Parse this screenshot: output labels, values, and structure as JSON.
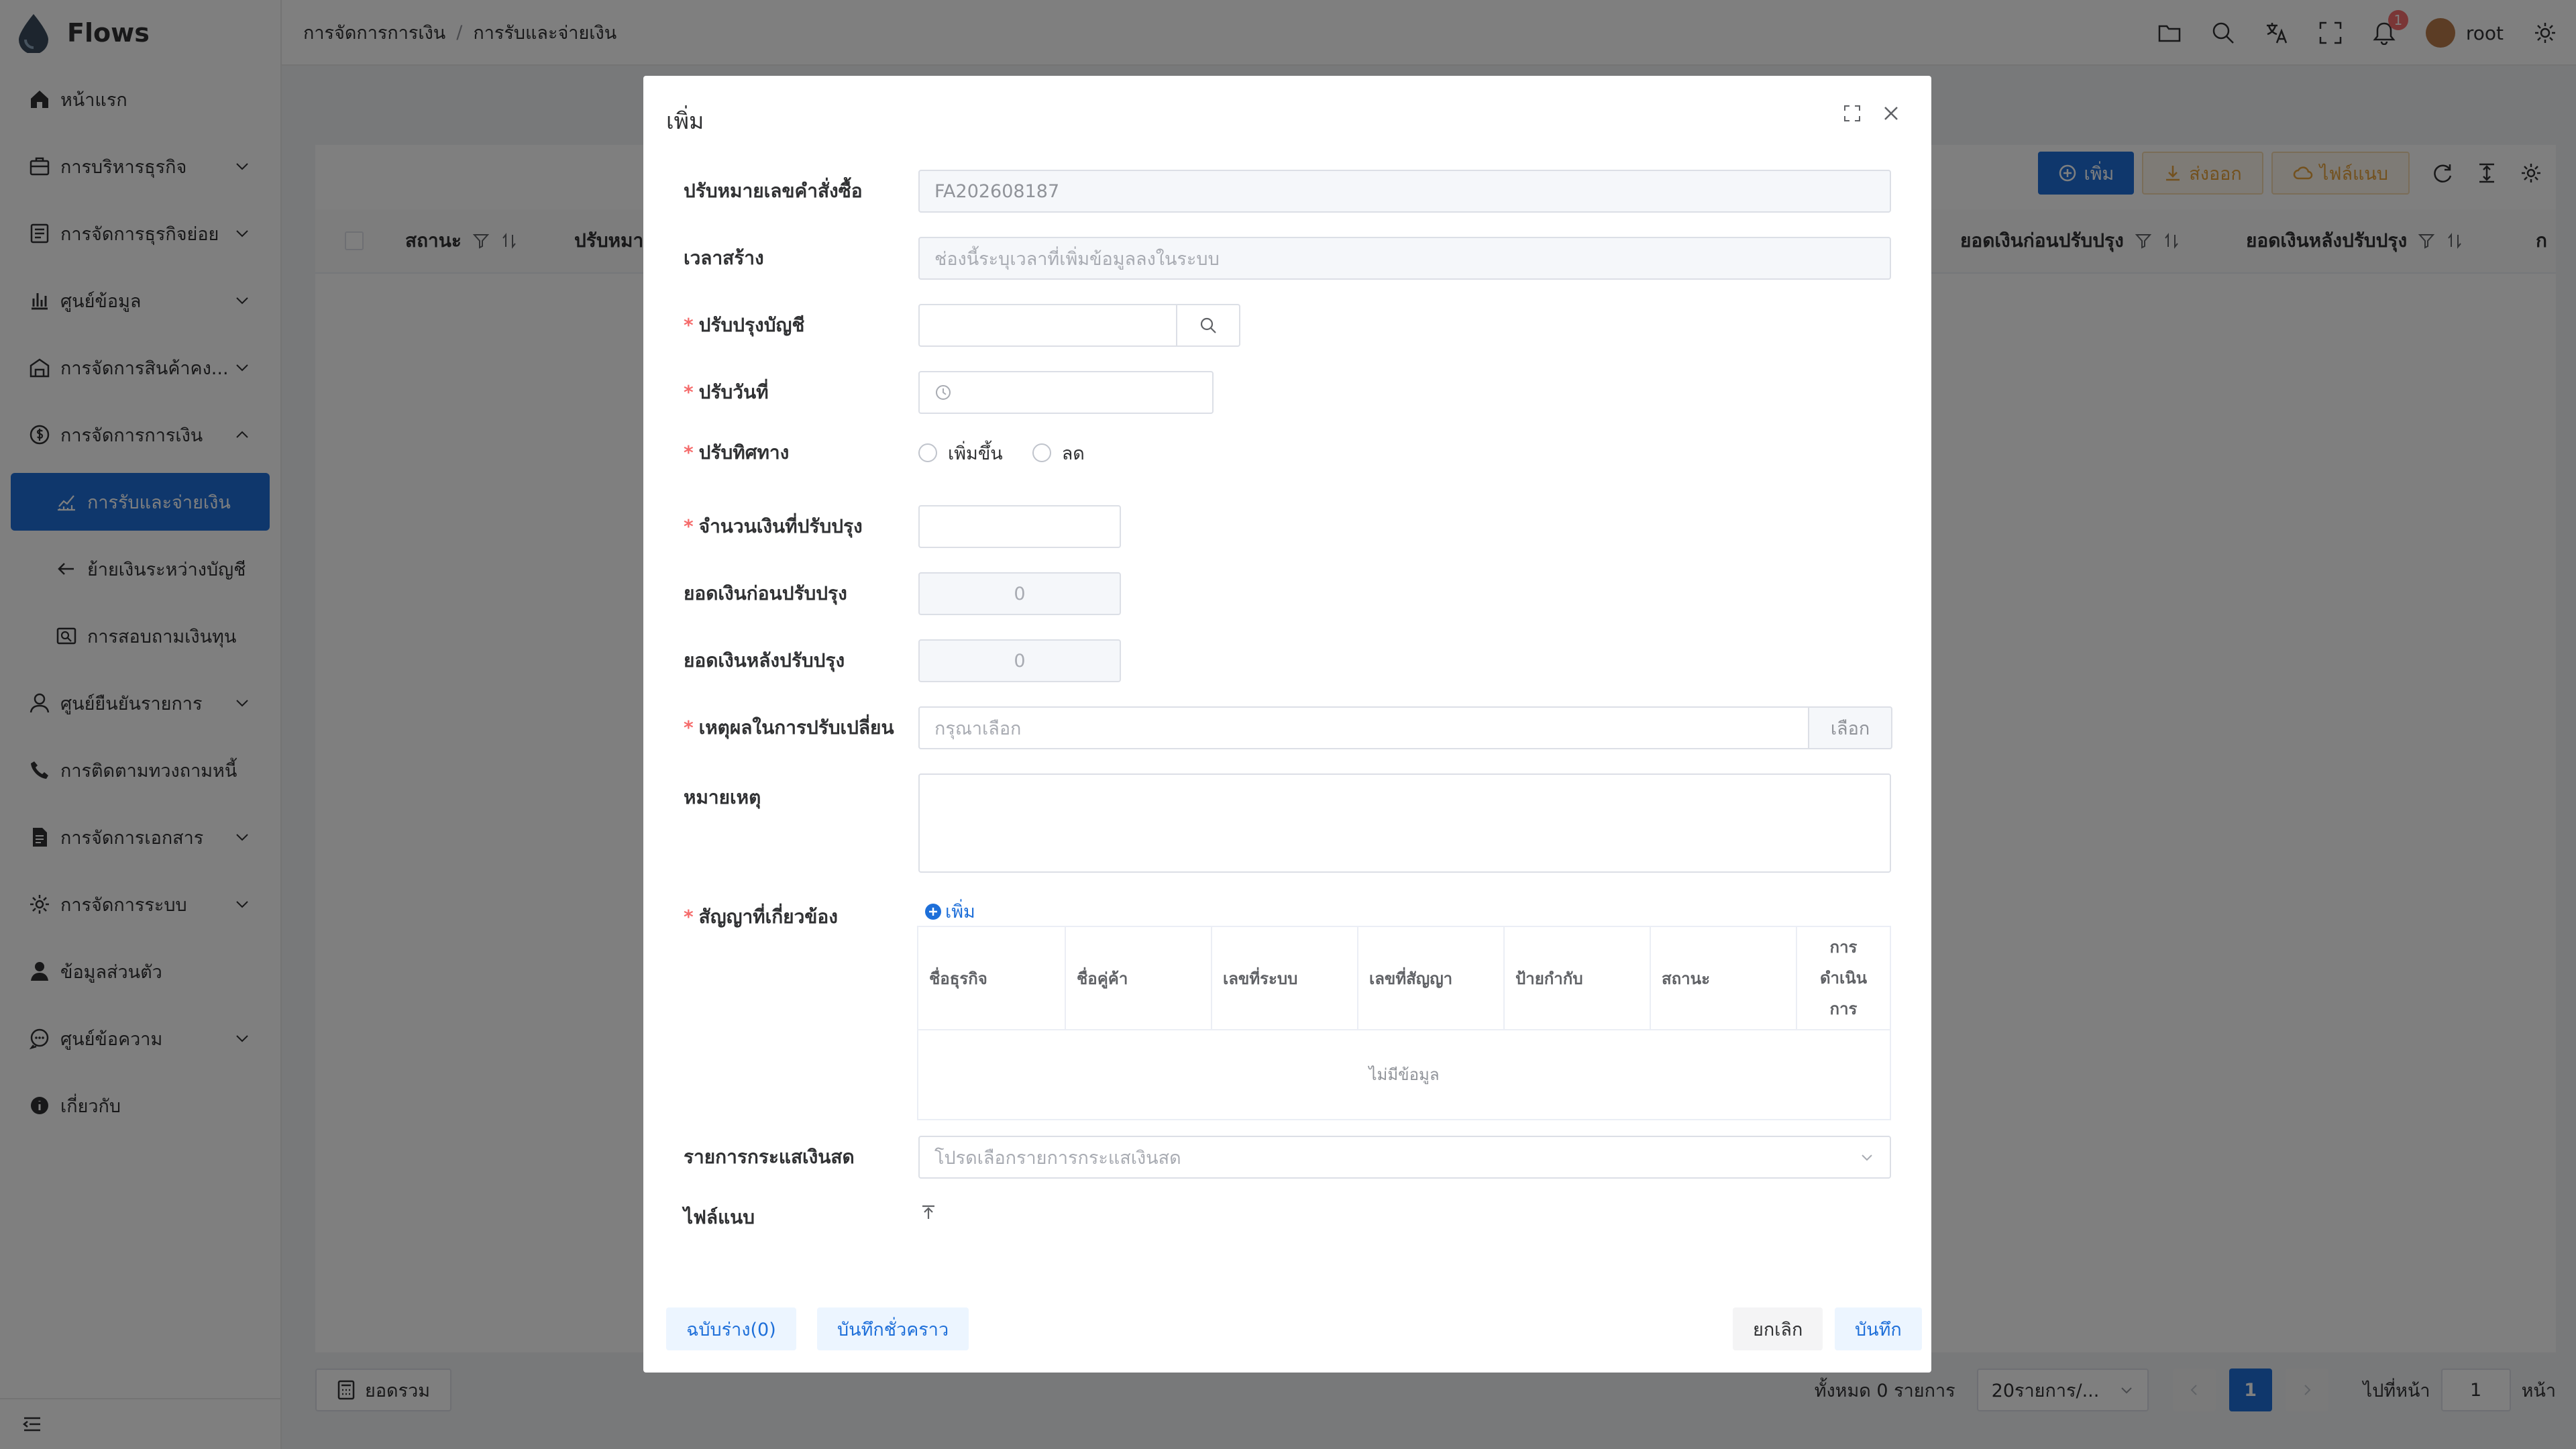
{
  "app": {
    "name": "Flows"
  },
  "sidebar": {
    "items": [
      {
        "label": "หน้าแรก",
        "icon": "home-icon",
        "expandable": false
      },
      {
        "label": "การบริหารธุรกิจ",
        "icon": "briefcase-icon",
        "expandable": true
      },
      {
        "label": "การจัดการธุรกิจย่อย",
        "icon": "list-icon",
        "expandable": true
      },
      {
        "label": "ศูนย์ข้อมูล",
        "icon": "bar-chart-icon",
        "expandable": true
      },
      {
        "label": "การจัดการสินค้าคง...",
        "icon": "warehouse-icon",
        "expandable": true
      },
      {
        "label": "การจัดการการเงิน",
        "icon": "money-icon",
        "expandable": true,
        "expanded": true
      },
      {
        "label": "การรับและจ่ายเงิน",
        "icon": "finance-chart-icon",
        "sub": true,
        "active": true
      },
      {
        "label": "ย้ายเงินระหว่างบัญชี",
        "icon": "arrow-left-icon",
        "sub": true
      },
      {
        "label": "การสอบถามเงินทุน",
        "icon": "fund-query-icon",
        "sub": true
      },
      {
        "label": "ศูนย์ยืนยันรายการ",
        "icon": "user-check-icon",
        "expandable": true
      },
      {
        "label": "การติดตามทวงถามหนี้",
        "icon": "phone-icon",
        "expandable": false
      },
      {
        "label": "การจัดการเอกสาร",
        "icon": "document-icon",
        "expandable": true
      },
      {
        "label": "การจัดการระบบ",
        "icon": "gear-icon",
        "expandable": true
      },
      {
        "label": "ข้อมูลส่วนตัว",
        "icon": "person-icon",
        "expandable": false
      },
      {
        "label": "ศูนย์ข้อความ",
        "icon": "message-icon",
        "expandable": true
      },
      {
        "label": "เกี่ยวกับ",
        "icon": "info-icon",
        "expandable": false
      }
    ]
  },
  "header": {
    "breadcrumb": [
      "การจัดการการเงิน",
      "การรับและจ่ายเงิน"
    ],
    "notification_count": "1",
    "user": "root"
  },
  "page": {
    "toolbar": {
      "add": "เพิ่ม",
      "export": "ส่งออก",
      "attach": "ไฟล์แนบ"
    },
    "columns": [
      "สถานะ",
      "ปรับหมา",
      "ยอดเงินก่อนปรับปรุง",
      "ยอดเงินหลังปรับปรุง",
      "ก"
    ],
    "summary_button": "ยอดรวม",
    "pagination": {
      "total": "ทั้งหมด 0 รายการ",
      "page_size": "20รายการ/...",
      "current": "1",
      "goto_label": "ไปที่หน้า",
      "goto_value": "1",
      "page_suffix": "หน้า"
    }
  },
  "modal": {
    "title": "เพิ่ม",
    "fields": {
      "order_no": {
        "label": "ปรับหมายเลขคำสั่งซื้อ",
        "value": "FA202608187"
      },
      "created_time": {
        "label": "เวลาสร้าง",
        "placeholder": "ช่องนี้ระบุเวลาที่เพิ่มข้อมูลลงในระบบ"
      },
      "account": {
        "label": "ปรับปรุงบัญชี"
      },
      "date": {
        "label": "ปรับวันที่"
      },
      "direction": {
        "label": "ปรับทิศทาง",
        "options": [
          "เพิ่มขึ้น",
          "ลด"
        ]
      },
      "amount": {
        "label": "จำนวนเงินที่ปรับปรุง"
      },
      "balance_before": {
        "label": "ยอดเงินก่อนปรับปรุง",
        "value": "0"
      },
      "balance_after": {
        "label": "ยอดเงินหลังปรับปรุง",
        "value": "0"
      },
      "reason": {
        "label": "เหตุผลในการปรับเปลี่ยน",
        "placeholder": "กรุณาเลือก",
        "button": "เลือก"
      },
      "remark": {
        "label": "หมายเหตุ"
      },
      "contracts": {
        "label": "สัญญาที่เกี่ยวข้อง",
        "add": "เพิ่ม",
        "columns": [
          "ชื่อธุรกิจ",
          "ชื่อคู่ค้า",
          "เลขที่ระบบ",
          "เลขที่สัญญา",
          "ป้ายกำกับ",
          "สถานะ",
          "การ ดำเนิน การ"
        ],
        "empty": "ไม่มีข้อมูล"
      },
      "cashflow": {
        "label": "รายการกระแสเงินสด",
        "placeholder": "โปรดเลือกรายการกระแสเงินสด"
      },
      "attachment": {
        "label": "ไฟล์แนบ"
      }
    },
    "footer": {
      "draft": "ฉบับร่าง(0)",
      "temp_save": "บันทึกชั่วคราว",
      "cancel": "ยกเลิก",
      "save": "บันทึก"
    }
  },
  "colors": {
    "primary": "#1e6fd9",
    "warning": "#e6a23c",
    "danger": "#f56c6c"
  }
}
